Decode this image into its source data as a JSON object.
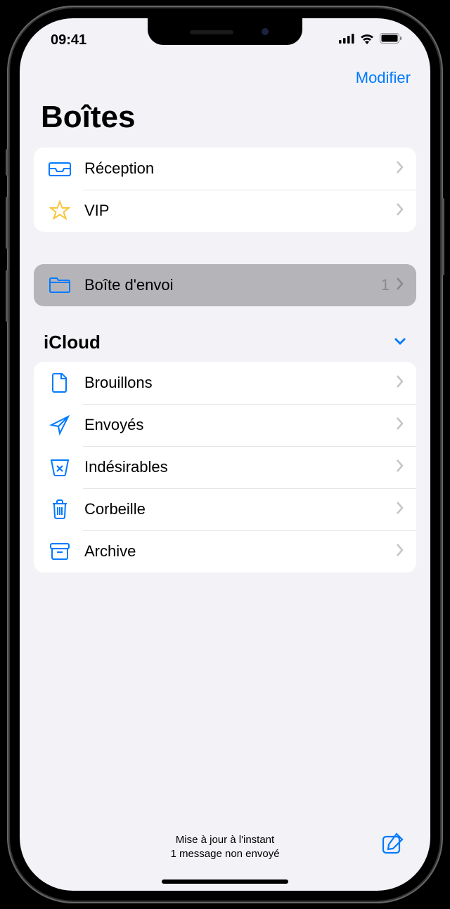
{
  "status": {
    "time": "09:41"
  },
  "nav": {
    "edit": "Modifier"
  },
  "title": "Boîtes",
  "favorites": [
    {
      "icon": "inbox-icon",
      "label": "Réception"
    },
    {
      "icon": "star-icon",
      "label": "VIP"
    }
  ],
  "outbox": {
    "icon": "folder-icon",
    "label": "Boîte d'envoi",
    "count": "1"
  },
  "account": {
    "name": "iCloud",
    "folders": [
      {
        "icon": "document-icon",
        "label": "Brouillons"
      },
      {
        "icon": "sent-icon",
        "label": "Envoyés"
      },
      {
        "icon": "junk-icon",
        "label": "Indésirables"
      },
      {
        "icon": "trash-icon",
        "label": "Corbeille"
      },
      {
        "icon": "archive-icon",
        "label": "Archive"
      }
    ]
  },
  "toolbar": {
    "status_line1": "Mise à jour à l'instant",
    "status_line2": "1 message non envoyé"
  }
}
